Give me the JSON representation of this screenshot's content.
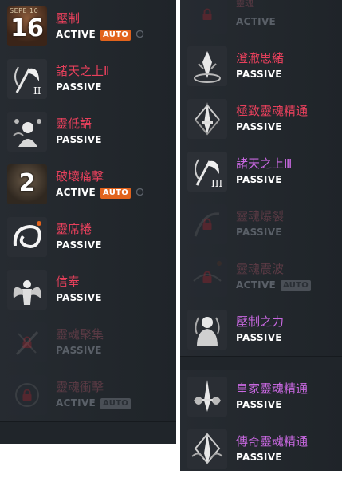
{
  "left_panel": {
    "skills": [
      {
        "name": "壓制",
        "type": "ACTIVE",
        "auto": "AUTO",
        "icon": "number-badge-icon",
        "badge": "16",
        "badge_caption": "SEPE 10",
        "locked": false
      },
      {
        "name": "諸天之上Ⅱ",
        "type": "PASSIVE",
        "icon": "scythe-icon",
        "locked": false
      },
      {
        "name": "靈低語",
        "type": "PASSIVE",
        "icon": "whisper-spirit-icon",
        "locked": false
      },
      {
        "name": "破壞痛擊",
        "type": "ACTIVE",
        "auto": "AUTO",
        "icon": "number-badge-icon",
        "badge": "2",
        "locked": false
      },
      {
        "name": "靈席捲",
        "type": "PASSIVE",
        "icon": "spiral-swirl-icon",
        "locked": false
      },
      {
        "name": "信奉",
        "type": "PASSIVE",
        "icon": "winged-figure-icon",
        "locked": false
      },
      {
        "name": "靈魂聚集",
        "type": "PASSIVE",
        "icon": "lock-icon",
        "locked": true
      },
      {
        "name": "靈魂衝擊",
        "type": "ACTIVE",
        "auto": "AUTO",
        "icon": "lock-icon",
        "locked": true
      }
    ]
  },
  "right_panel": {
    "partial_top": {
      "name": "靈魂",
      "type": "ACTIVE",
      "icon": "lock-icon",
      "locked": true
    },
    "skills": [
      {
        "name": "澄澈思緒",
        "type": "PASSIVE",
        "icon": "crystal-mind-icon",
        "locked": false,
        "color": "red"
      },
      {
        "name": "極致靈魂精通",
        "type": "PASSIVE",
        "icon": "sword-emblem-icon",
        "locked": false,
        "color": "red"
      },
      {
        "name": "諸天之上Ⅲ",
        "type": "PASSIVE",
        "icon": "scythe-icon",
        "locked": false,
        "color": "purple"
      },
      {
        "name": "靈魂爆裂",
        "type": "PASSIVE",
        "icon": "lock-icon",
        "locked": true
      },
      {
        "name": "靈魂震波",
        "type": "ACTIVE",
        "auto": "AUTO",
        "icon": "lock-icon",
        "locked": true
      },
      {
        "name": "壓制之力",
        "type": "PASSIVE",
        "icon": "dark-figure-icon",
        "locked": false,
        "color": "purple"
      },
      {
        "name": "皇家靈魂精通",
        "type": "PASSIVE",
        "icon": "sword-emblem-icon",
        "locked": false,
        "color": "purple"
      },
      {
        "name": "傳奇靈魂精通",
        "type": "PASSIVE",
        "icon": "sword-emblem-icon",
        "locked": false,
        "color": "purple"
      }
    ]
  },
  "colors": {
    "red_name": "#e8405c",
    "purple_name": "#c868e0",
    "auto_badge": "#e2631c",
    "lock": "#e0202c",
    "panel_bg": "#20252a"
  }
}
